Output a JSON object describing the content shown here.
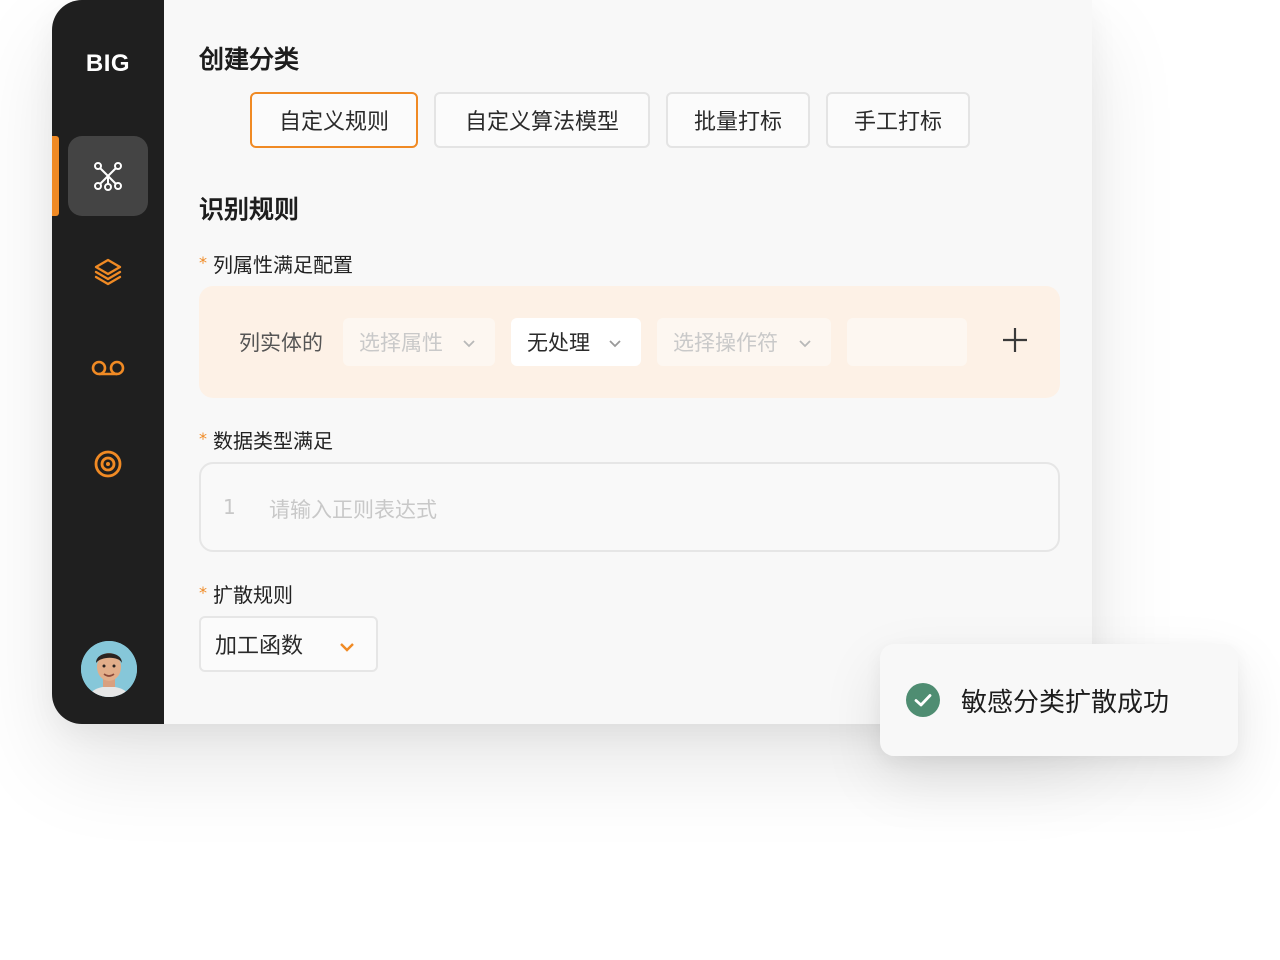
{
  "sidebar": {
    "brand": "BIG",
    "items": [
      {
        "icon": "network-icon",
        "active": true
      },
      {
        "icon": "layers-icon",
        "active": false
      },
      {
        "icon": "voicemail-icon",
        "active": false
      },
      {
        "icon": "target-icon",
        "active": false
      }
    ],
    "accent_color": "#f08a24"
  },
  "main": {
    "create_title": "创建分类",
    "tabs": [
      {
        "label": "自定义规则",
        "active": true
      },
      {
        "label": "自定义算法模型",
        "active": false
      },
      {
        "label": "批量打标",
        "active": false
      },
      {
        "label": "手工打标",
        "active": false
      }
    ],
    "rules_title": "识别规则",
    "column_config": {
      "required_mark": "*",
      "label": "列属性满足配置",
      "prefix": "列实体的",
      "attribute_select": {
        "placeholder": "选择属性"
      },
      "processing_select": {
        "value": "无处理"
      },
      "operator_select": {
        "placeholder": "选择操作符"
      },
      "value": ""
    },
    "data_type": {
      "required_mark": "*",
      "label": "数据类型满足",
      "line_number": "1",
      "placeholder": "请输入正则表达式"
    },
    "spread_rule": {
      "required_mark": "*",
      "label": "扩散规则",
      "value": "加工函数"
    }
  },
  "toast": {
    "icon": "check-circle-icon",
    "message": "敏感分类扩散成功",
    "color": "#4f8d72"
  }
}
